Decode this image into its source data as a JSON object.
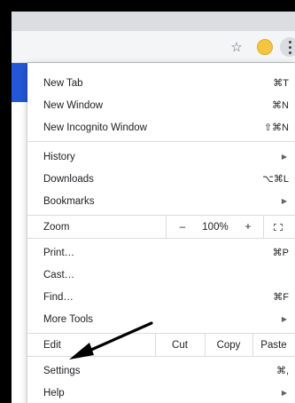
{
  "toolbar": {
    "bookmark_icon": "star-icon",
    "profile_icon": "avatar",
    "menu_icon": "kebab-menu-icon",
    "bookmark_glyph": "☆"
  },
  "menu": {
    "new_tab": {
      "label": "New Tab",
      "shortcut": "⌘T"
    },
    "new_window": {
      "label": "New Window",
      "shortcut": "⌘N"
    },
    "new_incognito": {
      "label": "New Incognito Window",
      "shortcut": "⇧⌘N"
    },
    "history": {
      "label": "History"
    },
    "downloads": {
      "label": "Downloads",
      "shortcut": "⌥⌘L"
    },
    "bookmarks": {
      "label": "Bookmarks"
    },
    "zoom": {
      "label": "Zoom",
      "minus": "–",
      "value": "100%",
      "plus": "+"
    },
    "print": {
      "label": "Print…",
      "shortcut": "⌘P"
    },
    "cast": {
      "label": "Cast…"
    },
    "find": {
      "label": "Find…",
      "shortcut": "⌘F"
    },
    "more_tools": {
      "label": "More Tools"
    },
    "edit": {
      "label": "Edit",
      "cut": "Cut",
      "copy": "Copy",
      "paste": "Paste"
    },
    "settings": {
      "label": "Settings",
      "shortcut": "⌘,"
    },
    "help": {
      "label": "Help"
    },
    "submenu_arrow": "▶"
  },
  "colors": {
    "accent_blue": "#2456d6",
    "annotation_arrow": "#000000"
  }
}
